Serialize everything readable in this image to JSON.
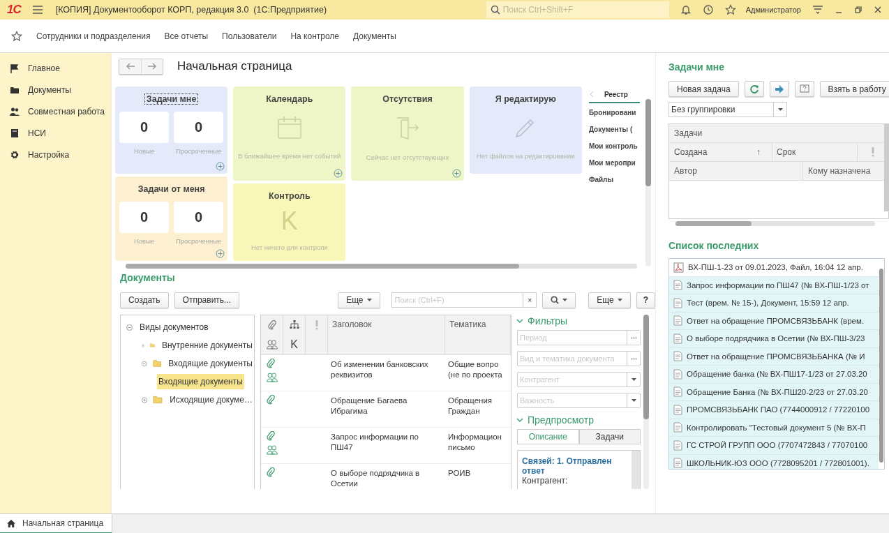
{
  "app": {
    "logo": "1С",
    "title": "[КОПИЯ] Документооборот КОРП, редакция 3.0  (1С:Предприятие)",
    "search_placeholder": "Поиск Ctrl+Shift+F",
    "user": "Администратор"
  },
  "nav": [
    "Сотрудники и подразделения",
    "Все отчеты",
    "Пользователи",
    "На контроле",
    "Документы"
  ],
  "sidebar": {
    "items": [
      "Главное",
      "Документы",
      "Совместная работа",
      "НСИ",
      "Настройка"
    ]
  },
  "page": {
    "title": "Начальная страница"
  },
  "widget_columns": [
    [
      {
        "title": "Задачи мне",
        "kind": "counters",
        "color": "#e4eafa",
        "focused": true,
        "add_button": true,
        "counters": [
          {
            "value": "0",
            "label": "Новые"
          },
          {
            "value": "0",
            "label": "Просроченные"
          }
        ]
      },
      {
        "title": "Задачи от меня",
        "kind": "counters",
        "color": "#fdf0d0",
        "focused": false,
        "add_button": true,
        "counters": [
          {
            "value": "0",
            "label": "Новые"
          },
          {
            "value": "0",
            "label": "Просроченные"
          }
        ]
      }
    ],
    [
      {
        "title": "Календарь",
        "kind": "calendar",
        "color": "#eef6c8",
        "focused": false,
        "add_button": true,
        "message": "В ближайшее время нет событий"
      },
      {
        "title": "Контроль",
        "kind": "glyph",
        "glyph": "K",
        "color": "#f8f6b8",
        "focused": false,
        "add_button": false,
        "message": "Нет ничего для контроля"
      }
    ],
    [
      {
        "title": "Отсутствия",
        "kind": "absence",
        "color": "#eef6c8",
        "focused": false,
        "add_button": true,
        "message": "Сейчас нет отсутствующих"
      }
    ],
    [
      {
        "title": "Я редактирую",
        "kind": "editing",
        "color": "#e4eafa",
        "focused": false,
        "add_button": false,
        "message": "Нет файлов на редактировании"
      }
    ]
  ],
  "side_tabs": {
    "tab": "Реестр",
    "items": [
      "Бронировани",
      "Документы (",
      "Мои контроль",
      "Мои меропри",
      "Файлы"
    ]
  },
  "documents": {
    "title": "Документы",
    "buttons": [
      "Создать",
      "Отправить..."
    ],
    "more": "Еще",
    "search_placeholder": "Поиск (Ctrl+F)",
    "clear": "×",
    "more_right": "Еще",
    "help": "?",
    "tree": [
      {
        "label": "Виды документов",
        "kind": "root",
        "expanded": true,
        "selected": false,
        "children": [
          {
            "label": "Внутренние документы",
            "kind": "folder",
            "expanded": false,
            "selected": false
          },
          {
            "label": "Входящие документы",
            "kind": "folder",
            "expanded": true,
            "selected": false,
            "children": [
              {
                "label": "Входящие документы",
                "kind": "leaf",
                "selected": true
              }
            ]
          },
          {
            "label": "Исходящие докуме…",
            "kind": "folder",
            "expanded": false,
            "selected": false
          }
        ]
      }
    ],
    "columns": [
      "Заголовок",
      "Тематика"
    ],
    "column_mark": "K",
    "rows": [
      {
        "attachment": true,
        "participants": true,
        "title_lines": [
          "Об изменении банковских",
          "реквизитов"
        ],
        "theme_lines": [
          "Общие вопро",
          "(не по проекта"
        ]
      },
      {
        "attachment": true,
        "participants": false,
        "title_lines": [
          "Обращение Багаева",
          "Ибрагима"
        ],
        "theme_lines": [
          "Обращения",
          "Граждан"
        ]
      },
      {
        "attachment": true,
        "participants": true,
        "title_lines": [
          "Запрос информации по ПШ47"
        ],
        "theme_lines": [
          "Информацион",
          "письмо"
        ]
      },
      {
        "attachment": true,
        "participants": false,
        "title_lines": [
          "О выборе подрядчика в",
          "Осетии"
        ],
        "theme_lines": [
          "РОИВ"
        ]
      }
    ],
    "filters": {
      "title": "Фильтры",
      "expanded": true,
      "fields": [
        {
          "placeholder": "Период",
          "kind": "choice"
        },
        {
          "placeholder": "Вид и тематика документа",
          "kind": "choice"
        },
        {
          "placeholder": "Контрагент",
          "kind": "dropdown"
        },
        {
          "placeholder": "Важность",
          "kind": "dropdown"
        }
      ]
    },
    "preview": {
      "title": "Предпросмотр",
      "expanded": true,
      "tabs": [
        {
          "label": "Описание",
          "selected": true
        },
        {
          "label": "Задачи",
          "selected": false
        }
      ],
      "heading": "Связей: 1. Отправлен ответ",
      "text": "Контрагент:"
    }
  },
  "tasks": {
    "title": "Задачи мне",
    "new_button": "Новая задача",
    "take_button": "Взять в работу",
    "grouping": "Без группировки",
    "caption": "Задачи",
    "header_rows": [
      [
        "Создана",
        "Срок"
      ],
      [
        "Автор",
        "Кому назначена"
      ]
    ],
    "sort_mark": "↑"
  },
  "recent": {
    "title": "Список последних",
    "items": [
      {
        "text": "ВХ-ПШ-1-23 от 09.01.2023, Файл, 16:04 12 апр.",
        "kind": "pdf",
        "selected": false
      },
      {
        "text": "Запрос информации по ПШ47 (№ ВХ-ПШ-1/23 от",
        "kind": "doc",
        "selected": true
      },
      {
        "text": "Тест (врем. № 15-), Документ, 15:59 12 апр.",
        "kind": "doc",
        "selected": true
      },
      {
        "text": "Ответ на обращение ПРОМСВЯЗЬБАНК (врем.",
        "kind": "doc",
        "selected": true
      },
      {
        "text": "О выборе подрядчика в Осетии (№ ВХ-ПШ-3/23",
        "kind": "doc",
        "selected": true
      },
      {
        "text": "Ответ на обращение ПРОМСВЯЗЬБАНКА (№ И",
        "kind": "doc",
        "selected": true
      },
      {
        "text": "Обращение банка (№ ВХ-ПШ17-1/23 от 27.03.20",
        "kind": "doc",
        "selected": true
      },
      {
        "text": "Обращение Банка (№ ВХ-ПШ20-2/23 от 27.03.20",
        "kind": "doc",
        "selected": true
      },
      {
        "text": "ПРОМСВЯЗЬБАНК ПАО (7744000912 / 77220100",
        "kind": "doc",
        "selected": true
      },
      {
        "text": "Контролировать \"Тестовый документ 5 (№ ВХ-П",
        "kind": "doc",
        "selected": true
      },
      {
        "text": "ГС СТРОЙ ГРУПП ООО (7707472843 / 77070100",
        "kind": "doc",
        "selected": true
      },
      {
        "text": "ШКОЛЬНИК-ЮЗ ООО (7728095201 / 772801001).",
        "kind": "doc",
        "selected": true
      }
    ]
  },
  "open_tabs": [
    {
      "label": "Начальная страница",
      "selected": true
    }
  ]
}
